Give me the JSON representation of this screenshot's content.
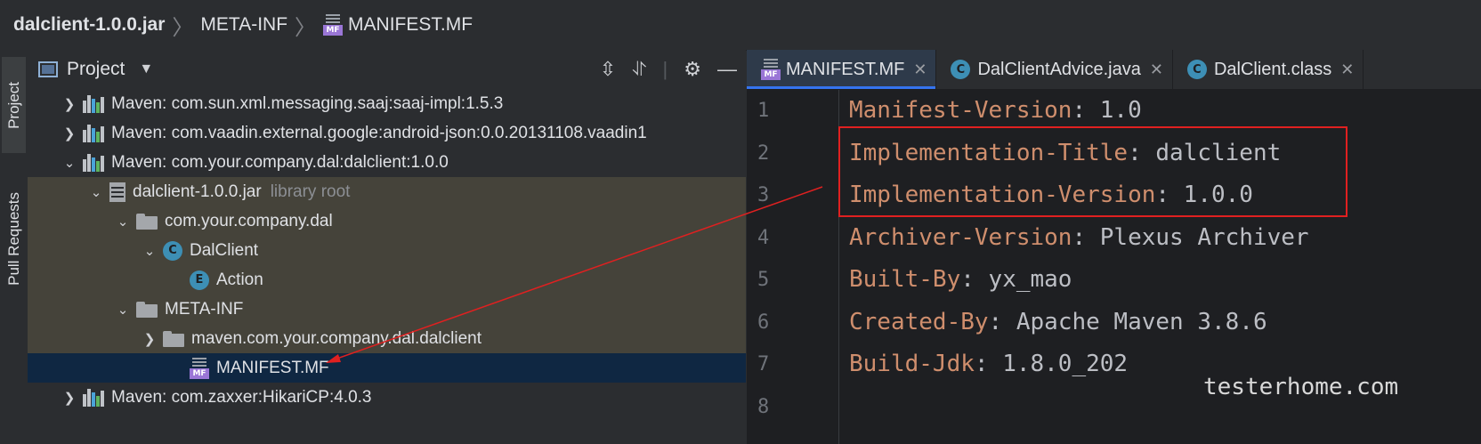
{
  "breadcrumb": {
    "jar": "dalclient-1.0.0.jar",
    "folder": "META-INF",
    "file": "MANIFEST.MF"
  },
  "side_tabs": {
    "project": "Project",
    "pull_requests": "Pull Requests"
  },
  "project_panel": {
    "title": "Project"
  },
  "icons": {
    "mf_tag": "MF",
    "class_letter": "C",
    "enum_letter": "E"
  },
  "tree": [
    {
      "label": "Maven: com.sun.xml.messaging.saaj:saaj-impl:1.5.3"
    },
    {
      "label": "Maven: com.vaadin.external.google:android-json:0.0.20131108.vaadin1"
    },
    {
      "label": "Maven: com.your.company.dal:dalclient:1.0.0"
    },
    {
      "label": "dalclient-1.0.0.jar",
      "note": "library root"
    },
    {
      "label": "com.your.company.dal"
    },
    {
      "label": "DalClient"
    },
    {
      "label": "Action"
    },
    {
      "label": "META-INF"
    },
    {
      "label": "maven.com.your.company.dal.dalclient"
    },
    {
      "label": "MANIFEST.MF"
    },
    {
      "label": "Maven: com.zaxxer:HikariCP:4.0.3"
    }
  ],
  "editor_tabs": [
    {
      "label": "MANIFEST.MF"
    },
    {
      "label": "DalClientAdvice.java"
    },
    {
      "label": "DalClient.class"
    }
  ],
  "line_numbers": [
    "1",
    "2",
    "3",
    "4",
    "5",
    "6",
    "7",
    "8"
  ],
  "code_lines": [
    {
      "key": "Manifest-Version",
      "value": ": 1.0"
    },
    {
      "key": "Implementation-Title",
      "value": ": dalclient"
    },
    {
      "key": "Implementation-Version",
      "value": ": 1.0.0"
    },
    {
      "key": "Archiver-Version",
      "value": ": Plexus Archiver"
    },
    {
      "key": "Built-By",
      "value": ": yx_mao"
    },
    {
      "key": "Created-By",
      "value": ": Apache Maven 3.8.6"
    },
    {
      "key": "Build-Jdk",
      "value": ": 1.8.0_202"
    }
  ],
  "watermark": "testerhome.com"
}
